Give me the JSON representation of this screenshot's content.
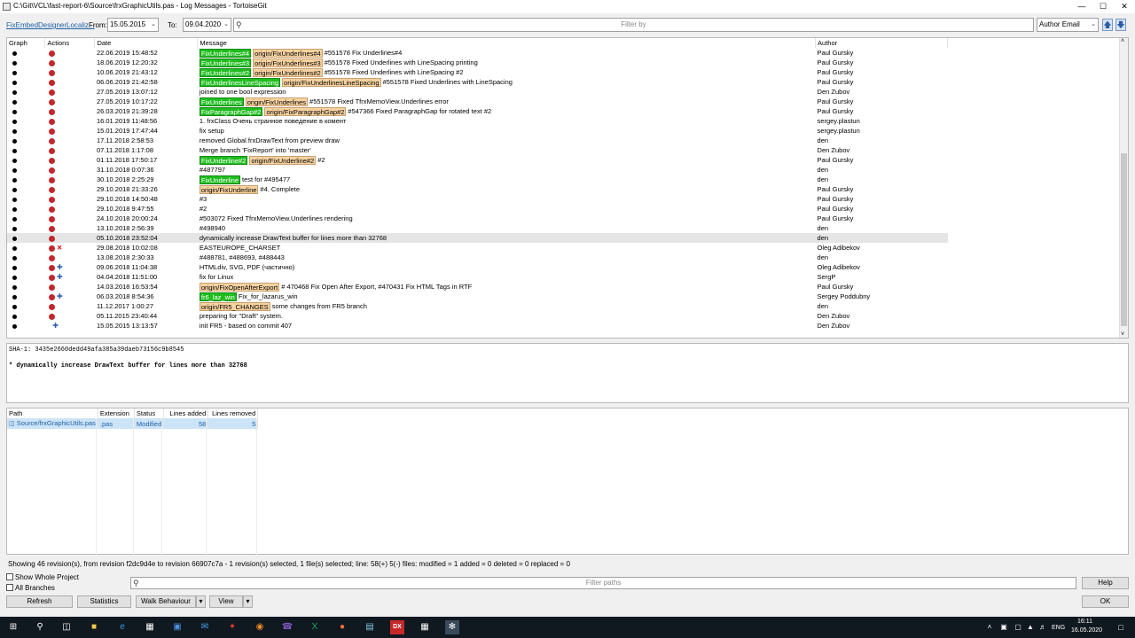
{
  "window": {
    "title": "C:\\Git\\VCL\\fast-report-6\\Source\\frxGraphicUtils.pas - Log Messages - TortoiseGit",
    "controls": {
      "minimize": "—",
      "maximize": "☐",
      "close": "✕"
    }
  },
  "toolbar": {
    "branch": "FixEmbedDesignerLocaliz...",
    "from_label": "From:",
    "from_value": "15.05.2015",
    "to_label": "To:",
    "to_value": "09.04.2020",
    "filter_placeholder": "Filter by",
    "filter_field": "Author Email"
  },
  "log": {
    "columns": [
      "Graph",
      "Actions",
      "Date",
      "Message",
      "Author"
    ],
    "rows": [
      {
        "date": "22.06.2019 15:48:52",
        "tags": [
          {
            "t": "FixUnderlines#4",
            "k": "g"
          },
          {
            "t": "origin/FixUnderlines#4",
            "k": "o"
          }
        ],
        "msg": "#551578 Fix Underlines#4",
        "author": "Paul Gursky"
      },
      {
        "date": "18.06.2019 12:20:32",
        "tags": [
          {
            "t": "FixUnderlines#3",
            "k": "g"
          },
          {
            "t": "origin/FixUnderlines#3",
            "k": "o"
          }
        ],
        "msg": "#551578 Fixed Underlines with LineSpacing printing",
        "author": "Paul Gursky"
      },
      {
        "date": "10.06.2019 21:43:12",
        "tags": [
          {
            "t": "FixUnderlines#2",
            "k": "g"
          },
          {
            "t": "origin/FixUnderlines#2",
            "k": "o"
          }
        ],
        "msg": "#551578 Fixed Underlines with LineSpacing #2",
        "author": "Paul Gursky"
      },
      {
        "date": "06.06.2019 21:42:58",
        "tags": [
          {
            "t": "FixUnderlinesLineSpacing",
            "k": "g"
          },
          {
            "t": "origin/FixUnderlinesLineSpacing",
            "k": "o"
          }
        ],
        "msg": "#551578 Fixed Underlines with LineSpacing",
        "author": "Paul Gursky"
      },
      {
        "date": "27.05.2019 13:07:12",
        "tags": [],
        "msg": "joined to one bool expression",
        "author": "Den Zubov"
      },
      {
        "date": "27.05.2019 10:17:22",
        "tags": [
          {
            "t": "FixUnderlines",
            "k": "g"
          },
          {
            "t": "origin/FixUnderlines",
            "k": "o"
          }
        ],
        "msg": "#551578 Fixed TfrxMemoView.Underlines error",
        "author": "Paul Gursky"
      },
      {
        "date": "26.03.2019 21:39:28",
        "tags": [
          {
            "t": "FixParagraphGap#2",
            "k": "g"
          },
          {
            "t": "origin/FixParagraphGap#2",
            "k": "o"
          }
        ],
        "msg": "#547366 Fixed ParagraphGap for rotated text #2",
        "author": "Paul Gursky"
      },
      {
        "date": "16.01.2019 11:48:56",
        "tags": [],
        "msg": "1. frxClass Очень странное поведение в комент",
        "author": "sergey.plastun"
      },
      {
        "date": "15.01.2019 17:47:44",
        "tags": [],
        "msg": "fix setup",
        "author": "sergey.plastun"
      },
      {
        "date": "17.11.2018 2:58:53",
        "tags": [],
        "msg": "removed Global frxDrawText from preview draw",
        "author": "den"
      },
      {
        "date": "07.11.2018 1:17:08",
        "tags": [],
        "msg": "Merge branch 'FixReport' into 'master'",
        "author": "Den Zubov"
      },
      {
        "date": "01.11.2018 17:50:17",
        "tags": [
          {
            "t": "FixUnderline#2",
            "k": "g"
          },
          {
            "t": "origin/FixUnderline#2",
            "k": "o"
          }
        ],
        "msg": "#2",
        "author": "Paul Gursky"
      },
      {
        "date": "31.10.2018 0:07:36",
        "tags": [],
        "msg": "#487797",
        "author": "den"
      },
      {
        "date": "30.10.2018 2:25:29",
        "tags": [
          {
            "t": "FixUnderline",
            "k": "g"
          }
        ],
        "msg": "test for #495477",
        "author": "den"
      },
      {
        "date": "29.10.2018 21:33:26",
        "tags": [
          {
            "t": "origin/FixUnderline",
            "k": "o"
          }
        ],
        "msg": "#4. Complete",
        "author": "Paul Gursky"
      },
      {
        "date": "29.10.2018 14:50:48",
        "tags": [],
        "msg": "#3",
        "author": "Paul Gursky"
      },
      {
        "date": "29.10.2018 9:47:55",
        "tags": [],
        "msg": "#2",
        "author": "Paul Gursky"
      },
      {
        "date": "24.10.2018 20:00:24",
        "tags": [],
        "msg": "#503072 Fixed TfrxMemoView.Underlines rendering",
        "author": "Paul Gursky"
      },
      {
        "date": "13.10.2018 2:56:39",
        "tags": [],
        "msg": "#498940",
        "author": "den"
      },
      {
        "date": "05.10.2018 23:52:04",
        "tags": [],
        "msg": "dynamically increase DrawText buffer for lines more than 32768",
        "author": "den",
        "selected": true
      },
      {
        "date": "29.08.2018 10:02:08",
        "tags": [],
        "msg": "EASTEUROPE_CHARSET",
        "author": "Oleg Adibekov",
        "extra": "x"
      },
      {
        "date": "13.08.2018 2:30:33",
        "tags": [],
        "msg": "#488781, #488693, #488443",
        "author": "den"
      },
      {
        "date": "09.06.2018 11:04:38",
        "tags": [],
        "msg": "HTMLdiv, SVG, PDF (частично)",
        "author": "Oleg Adibekov",
        "extra": "a"
      },
      {
        "date": "04.04.2018 11:51:00",
        "tags": [],
        "msg": "fix for Linux",
        "author": "SergP",
        "extra": "a"
      },
      {
        "date": "14.03.2018 16:53:54",
        "tags": [
          {
            "t": "origin/FixOpenAfterExport",
            "k": "o"
          }
        ],
        "msg": "# 470468 Fix Open After Export, #470431 Fix HTML Tags in RTF",
        "author": "Paul Gursky"
      },
      {
        "date": "06.03.2018 8:54:36",
        "tags": [
          {
            "t": "fr6_laz_win",
            "k": "g"
          }
        ],
        "msg": "Fix_for_lazarus_win",
        "author": "Sergey Poddubny",
        "extra": "a"
      },
      {
        "date": "11.12.2017 1:00:27",
        "tags": [
          {
            "t": "origin/FR5_CHANGES",
            "k": "o"
          }
        ],
        "msg": "some changes from FR5 branch",
        "author": "den"
      },
      {
        "date": "05.11.2015 23:40:44",
        "tags": [],
        "msg": "preparing for \"Draft\" system.",
        "author": "Den Zubov"
      },
      {
        "date": "15.05.2015 13:13:57",
        "tags": [],
        "msg": "init FR5 - based on commit 407",
        "author": "Den Zubov",
        "extra": "a",
        "noaction": true
      }
    ]
  },
  "detail": {
    "sha": "SHA-1: 3435e2660dedd49afa385a39daeb73156c9b8545",
    "message": "* dynamically increase DrawText buffer for lines more than 32768"
  },
  "files": {
    "columns": [
      "Path",
      "Extension",
      "Status",
      "Lines added",
      "Lines removed"
    ],
    "rows": [
      {
        "path": "Source/frxGraphicUtils.pas",
        "ext": ".pas",
        "status": "Modified",
        "added": "58",
        "removed": "5"
      }
    ]
  },
  "status_text": "Showing 46 revision(s), from revision f2dc9d4e to revision 66907c7a - 1 revision(s) selected, 1 file(s) selected; line: 58(+) 5(-) files: modified = 1 added = 0 deleted = 0 replaced = 0",
  "options": {
    "show_whole_project": "Show Whole Project",
    "all_branches": "All Branches",
    "filter_paths_placeholder": "Filter paths"
  },
  "buttons": {
    "help": "Help",
    "refresh": "Refresh",
    "statistics": "Statistics",
    "walk_behaviour": "Walk Behaviour",
    "view": "View",
    "ok": "OK"
  },
  "taskbar": {
    "time": "16:11",
    "date": "16.05.2020",
    "lang": "ENG"
  }
}
